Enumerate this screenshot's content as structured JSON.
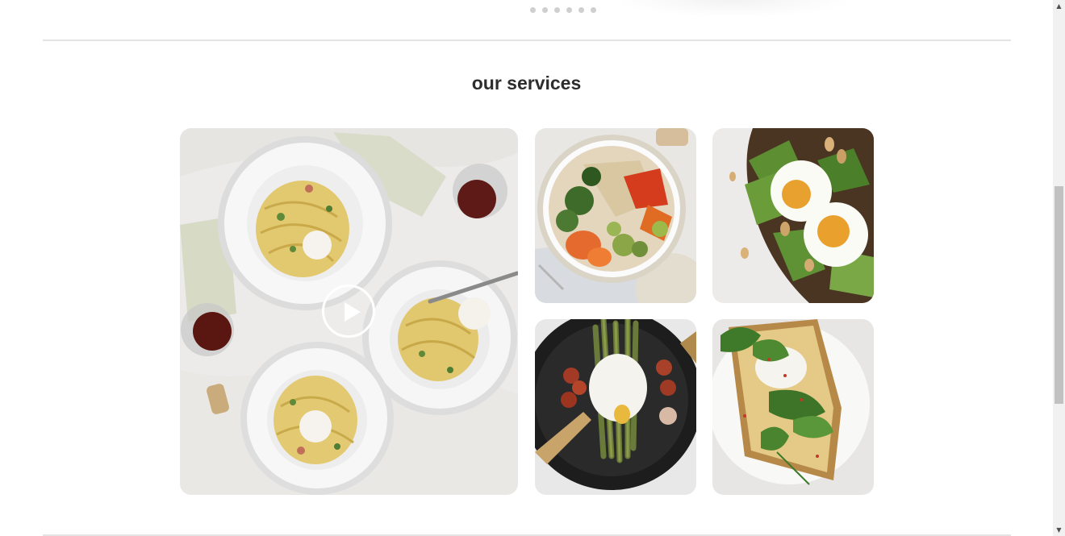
{
  "carousel": {
    "dot_count": 6
  },
  "services": {
    "title": "our services",
    "video_tile": {
      "icon": "play-icon"
    },
    "tiles": [
      {
        "subject": "grain bowl with roasted vegetables"
      },
      {
        "subject": "avocado toast with soft-boiled eggs"
      },
      {
        "subject": "poached egg with asparagus and tomatoes"
      },
      {
        "subject": "avocado toast with spinach and egg"
      }
    ]
  },
  "scrollbar": {
    "up_icon": "▲",
    "down_icon": "▼"
  }
}
